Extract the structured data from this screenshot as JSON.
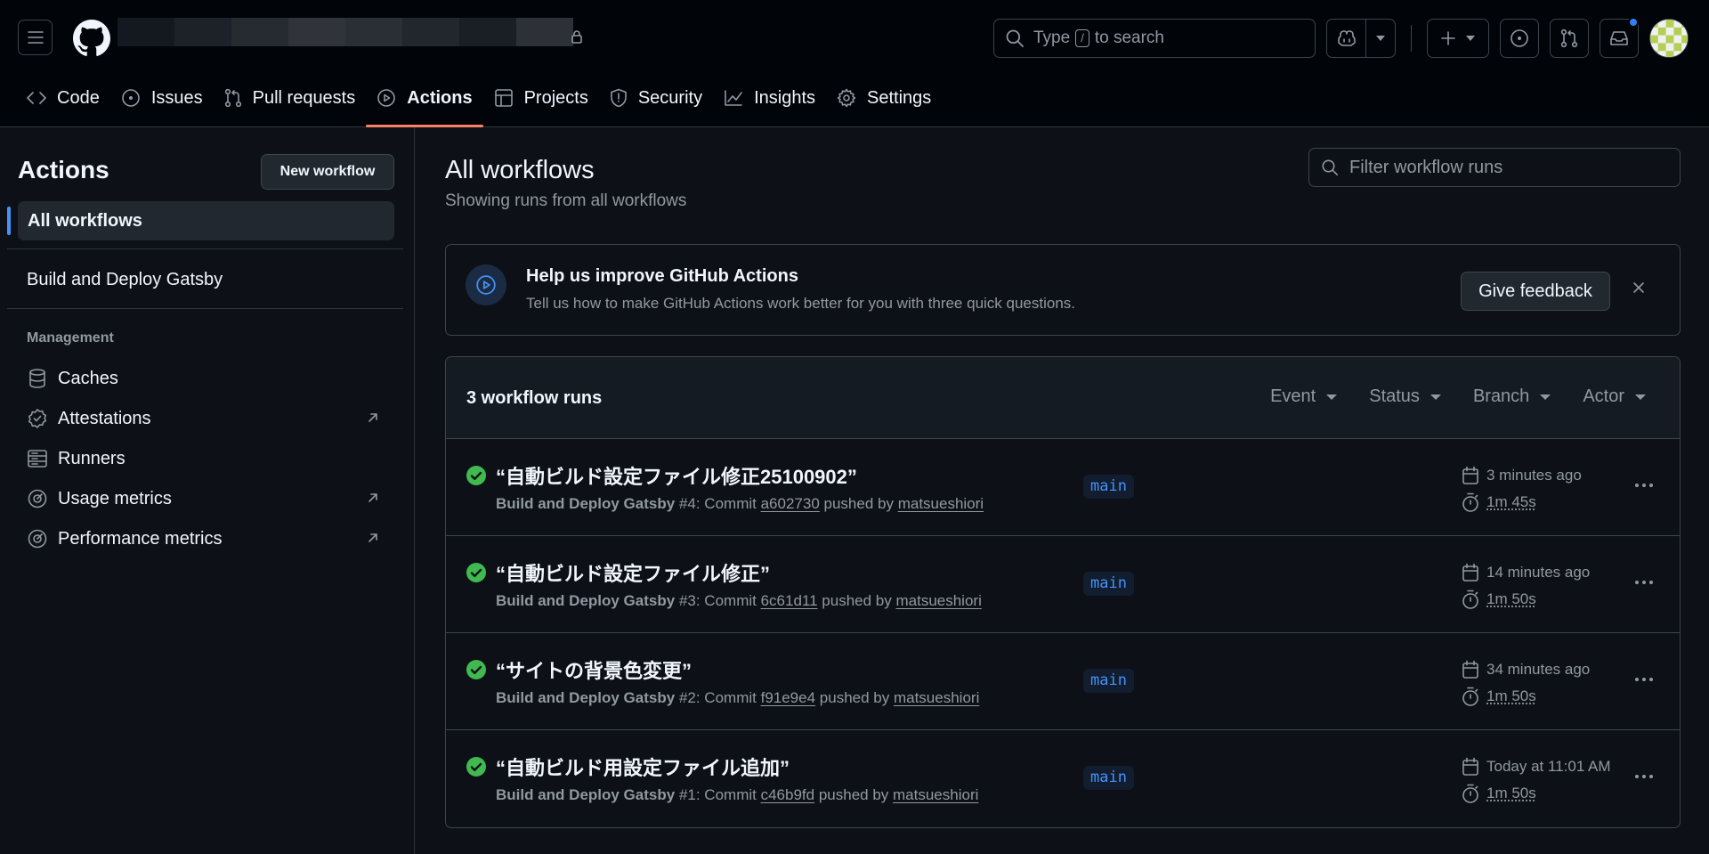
{
  "header": {
    "search": {
      "prefix": "Type",
      "key": "/",
      "suffix": "to search"
    }
  },
  "tabs": [
    {
      "label": "Code",
      "icon": "code-icon"
    },
    {
      "label": "Issues",
      "icon": "issue-icon"
    },
    {
      "label": "Pull requests",
      "icon": "pull-request-icon"
    },
    {
      "label": "Actions",
      "icon": "play-icon",
      "active": true
    },
    {
      "label": "Projects",
      "icon": "table-icon"
    },
    {
      "label": "Security",
      "icon": "shield-icon"
    },
    {
      "label": "Insights",
      "icon": "graph-icon"
    },
    {
      "label": "Settings",
      "icon": "gear-icon"
    }
  ],
  "sidebar": {
    "title": "Actions",
    "new_workflow": "New workflow",
    "all_workflows": "All workflows",
    "workflows": [
      "Build and Deploy Gatsby"
    ],
    "management_label": "Management",
    "management": [
      {
        "label": "Caches",
        "icon": "database-icon",
        "external": false
      },
      {
        "label": "Attestations",
        "icon": "verified-icon",
        "external": true
      },
      {
        "label": "Runners",
        "icon": "server-icon",
        "external": false
      },
      {
        "label": "Usage metrics",
        "icon": "meter-icon",
        "external": true
      },
      {
        "label": "Performance metrics",
        "icon": "meter-icon",
        "external": true
      }
    ]
  },
  "main": {
    "title": "All workflows",
    "subtitle": "Showing runs from all workflows",
    "filter_placeholder": "Filter workflow runs",
    "banner": {
      "title": "Help us improve GitHub Actions",
      "text": "Tell us how to make GitHub Actions work better for you with three quick questions.",
      "button": "Give feedback"
    },
    "runs_count": "3 workflow runs",
    "filters": [
      "Event",
      "Status",
      "Branch",
      "Actor"
    ],
    "runs": [
      {
        "title": "“自動ビルド設定ファイル修正25100902”",
        "workflow": "Build and Deploy Gatsby",
        "number": "#4",
        "commit_label": ": Commit",
        "commit": "a602730",
        "pushed_by": "pushed by",
        "actor": "matsueshiori",
        "branch": "main",
        "when": "3 minutes ago",
        "duration": "1m 45s",
        "status": "success"
      },
      {
        "title": "“自動ビルド設定ファイル修正”",
        "workflow": "Build and Deploy Gatsby",
        "number": "#3",
        "commit_label": ": Commit",
        "commit": "6c61d11",
        "pushed_by": "pushed by",
        "actor": "matsueshiori",
        "branch": "main",
        "when": "14 minutes ago",
        "duration": "1m 50s",
        "status": "success"
      },
      {
        "title": "“サイトの背景色変更”",
        "workflow": "Build and Deploy Gatsby",
        "number": "#2",
        "commit_label": ": Commit",
        "commit": "f91e9e4",
        "pushed_by": "pushed by",
        "actor": "matsueshiori",
        "branch": "main",
        "when": "34 minutes ago",
        "duration": "1m 50s",
        "status": "success"
      },
      {
        "title": "“自動ビルド用設定ファイル追加”",
        "workflow": "Build and Deploy Gatsby",
        "number": "#1",
        "commit_label": ": Commit",
        "commit": "c46b9fd",
        "pushed_by": "pushed by",
        "actor": "matsueshiori",
        "branch": "main",
        "when": "Today at 11:01 AM",
        "duration": "1m 50s",
        "status": "success"
      }
    ]
  },
  "colors": {
    "accent": "#4493f8",
    "success": "#3fb950",
    "tab_underline": "#f78166",
    "background": "#0d1117",
    "header_bg": "#010409"
  }
}
